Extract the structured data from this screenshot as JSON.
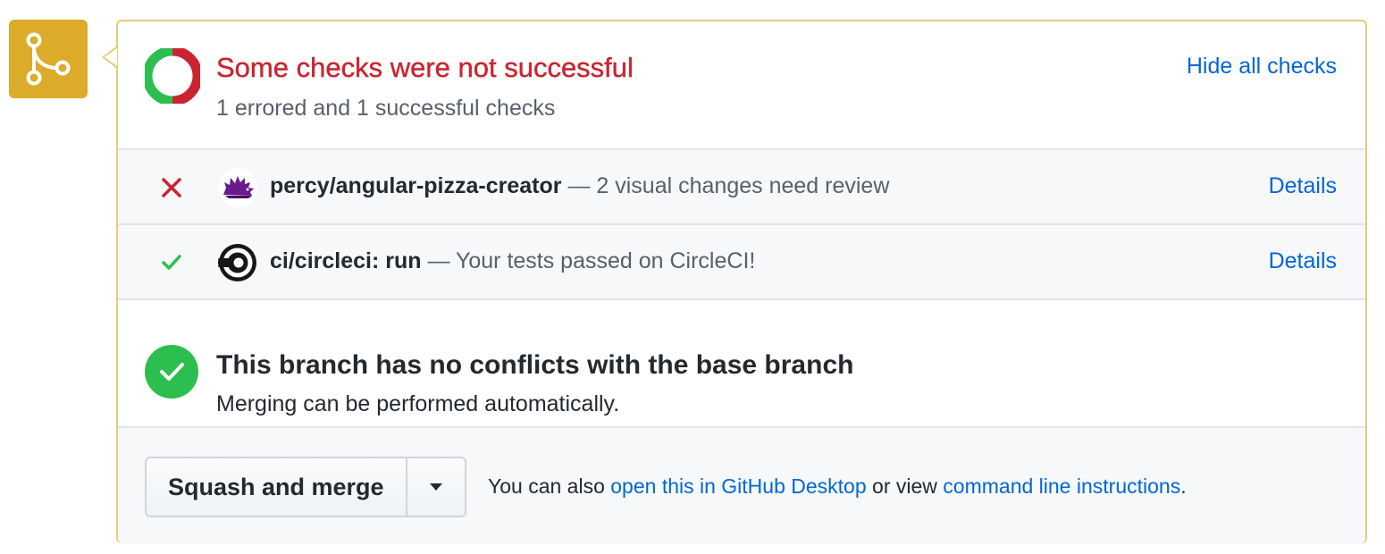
{
  "status": {
    "title": "Some checks were not successful",
    "subtitle": "1 errored and 1 successful checks",
    "toggle_link": "Hide all checks",
    "colors": {
      "error": "#cb2431",
      "success": "#2cbe4e"
    }
  },
  "checks": [
    {
      "state": "error",
      "status_icon": "x-icon",
      "avatar_icon": "percy-hedgehog-icon",
      "context": "percy/angular-pizza-creator",
      "separator": " — ",
      "description": "2 visual changes need review",
      "details_label": "Details"
    },
    {
      "state": "success",
      "status_icon": "check-icon",
      "avatar_icon": "circleci-icon",
      "context": "ci/circleci: run",
      "separator": " — ",
      "description": "Your tests passed on CircleCI!",
      "details_label": "Details"
    }
  ],
  "conflicts": {
    "title": "This branch has no conflicts with the base branch",
    "subtitle": "Merging can be performed automatically."
  },
  "merge": {
    "button_label": "Squash and merge",
    "dropdown_icon": "caret-down-icon",
    "hint_prefix": "You can also ",
    "hint_link_1": "open this in GitHub Desktop",
    "hint_middle": " or view ",
    "hint_link_2": "command line instructions",
    "hint_suffix": "."
  },
  "badge": {
    "icon": "git-merge-icon",
    "color": "#dbab29"
  }
}
